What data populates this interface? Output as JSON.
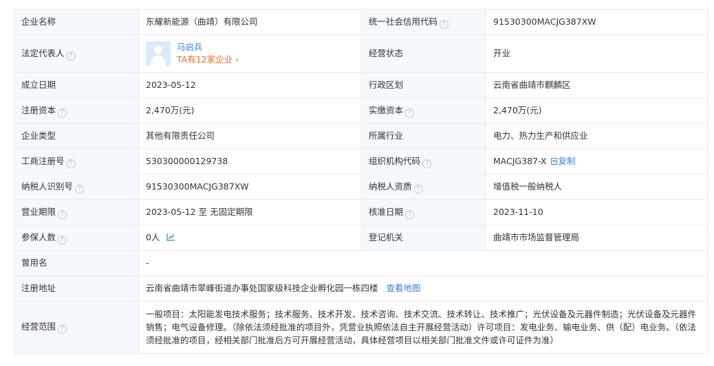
{
  "company_name": {
    "label": "企业名称",
    "value": "东耀新能源（曲靖）有限公司"
  },
  "credit_code": {
    "label": "统一社会信用代码",
    "value": "91530300MACJG387XW"
  },
  "legal_rep": {
    "label": "法定代表人",
    "name": "马启兵",
    "companies": "TA有12家企业 ›"
  },
  "status": {
    "label": "经营状态",
    "value": "开业"
  },
  "established": {
    "label": "成立日期",
    "value": "2023-05-12"
  },
  "region": {
    "label": "行政区划",
    "value": "云南省曲靖市麒麟区"
  },
  "reg_capital": {
    "label": "注册资本",
    "value": "2,470万(元)"
  },
  "paid_capital": {
    "label": "实缴资本",
    "value": "2,470万(元)"
  },
  "company_type": {
    "label": "企业类型",
    "value": "其他有限责任公司"
  },
  "industry": {
    "label": "所属行业",
    "value": "电力、热力生产和供应业"
  },
  "biz_reg_no": {
    "label": "工商注册号",
    "value": "530300000129738"
  },
  "org_code": {
    "label": "组织机构代码",
    "value": "MACJG387-X",
    "copy": "复制"
  },
  "taxpayer_id": {
    "label": "纳税人识别号",
    "value": "91530300MACJG387XW"
  },
  "taxpayer_qual": {
    "label": "纳税人资质",
    "value": "增值税一般纳税人"
  },
  "biz_term": {
    "label": "营业期限",
    "value": "2023-05-12 至 无固定期限"
  },
  "approval_date": {
    "label": "核准日期",
    "value": "2023-11-10"
  },
  "insured": {
    "label": "参保人数",
    "value": "0人"
  },
  "reg_authority": {
    "label": "登记机关",
    "value": "曲靖市市场监督管理局"
  },
  "former_name": {
    "label": "曾用名",
    "value": "-"
  },
  "address": {
    "label": "注册地址",
    "value": "云南省曲靖市翠峰街道办事处国家级科技企业孵化园一栋四楼",
    "map": "查看地图"
  },
  "scope": {
    "label": "经营范围",
    "value": "一般项目：太阳能发电技术服务；技术服务、技术开发、技术咨询、技术交流、技术转让、技术推广；光伏设备及元器件制造；光伏设备及元器件销售；电气设备修理。（除依法须经批准的项目外，凭营业执照依法自主开展经营活动）许可项目：发电业务、输电业务、供（配）电业务。（依法须经批准的项目，经相关部门批准后方可开展经营活动，具体经营项目以相关部门批准文件或许可证件为准）"
  },
  "help_icon": "question-circle-icon",
  "colors": {
    "label_bg": "#f5f8fc",
    "border": "#e8ebf0",
    "link": "#3c7ddb",
    "accent": "#f06b26"
  }
}
